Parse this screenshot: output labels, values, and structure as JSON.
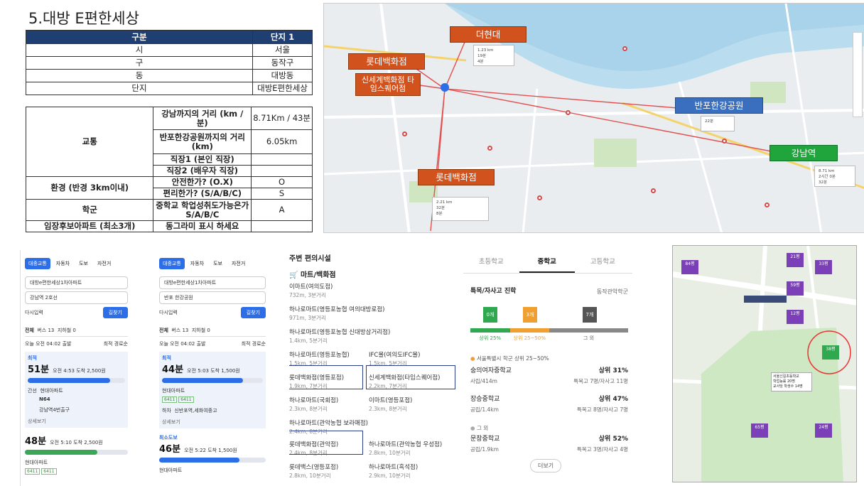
{
  "title": "5.대방 E편한세상",
  "table1": {
    "header": [
      "구분",
      "단지 1"
    ],
    "rows": [
      [
        "시",
        "서울"
      ],
      [
        "구",
        "동작구"
      ],
      [
        "동",
        "대방동"
      ],
      [
        "단지",
        "대방E편한세상"
      ]
    ]
  },
  "table2": {
    "traffic": "교통",
    "r1_label": "강남까지의 거리 (km / 분)",
    "r1_val": "8.71Km / 43분",
    "r2_label": "반포한강공원까지의 거리 (km)",
    "r2_val": "6.05km",
    "r3_label": "직장1 (본인 직장)",
    "r4_label": "직장2 (배우자 직장)",
    "env": "환경 (반경 3km이내)",
    "r5_label": "안전한가? (O.X)",
    "r5_val": "O",
    "r6_label": "편리한가? (S/A/B/C)",
    "r6_val": "S",
    "school": "학군",
    "r7_label": "중학교 학업성취도가능은가 S/A/B/C",
    "r7_val": "A",
    "apt": "임장후보아파트 (최소3개)",
    "r8_label": "동그라미 표시 하세요"
  },
  "map_labels": {
    "hyundai": "더현대",
    "lotte1": "롯데백화점",
    "shinsegae": "신세계백화점 타임스퀘어점",
    "banpo": "반포한강공원",
    "gangnam": "강남역",
    "lotte2": "롯데백화점"
  },
  "route1": {
    "tabs": [
      "대중교통",
      "자동차",
      "도보",
      "자전거"
    ],
    "from": "대방e편한세상1차아파트",
    "to": "강남역 2호선",
    "reset": "다시입력",
    "search": "길찾기",
    "filters": [
      "전체",
      "버스 13",
      "지하철 0"
    ],
    "departure": "오늘 오전 04:02 출발",
    "sort": "최적 경로순",
    "best": "최적",
    "opt1_time": "51분",
    "opt1_detail": "오전 4:53 도착  2,500원",
    "bus_label": "간선",
    "bus_stop": "현대아파트",
    "bus_no": "N64",
    "bus_stop2": "강남역4번출구",
    "detail": "상세보기",
    "opt2_time": "48분",
    "opt2_detail": "오전 5:10 도착  2,500원",
    "opt2_stop": "현대아파트",
    "bus1": "6411",
    "bus2": "6411"
  },
  "route2": {
    "tabs": [
      "대중교통",
      "자동차",
      "도보",
      "자전거"
    ],
    "from": "대방e편한세상1차아파트",
    "to": "반포 한강공원",
    "reset": "다시입력",
    "search": "길찾기",
    "filters": [
      "전체",
      "버스 13",
      "지하철 0"
    ],
    "departure": "오늘 오전 04:02 출발",
    "sort": "최적 경로순",
    "best": "최적",
    "opt1_time": "44분",
    "opt1_detail": "오전 5:03 도착  1,500원",
    "opt1_stop": "현대아파트",
    "bus1": "6411",
    "bus2": "6411",
    "walk_label": "하차",
    "walk_stop": "신반포역,세화여중고",
    "detail": "상세보기",
    "min_walk": "최소도보",
    "opt2_time": "46분",
    "opt2_detail": "오전 5:22 도착  1,500원",
    "opt2_stop": "현대아파트"
  },
  "shop": {
    "h1": "주변 편의시설",
    "h2": "마트/백화점",
    "items": [
      {
        "name": "이마트(여의도점)",
        "sub": "732m, 3분거리"
      },
      {
        "name": "하나로마트(영등포농협 여의대방로점)",
        "sub": "971m, 3분거리"
      },
      {
        "name": "하나로마트(영등포농협 신대방삼거리점)",
        "sub": "1.4km, 5분거리"
      },
      {
        "name": "하나로마트(영등포농협)",
        "sub": "1.5km, 5분거리"
      },
      {
        "name": "IFC몰(여의도IFC몰)",
        "sub": "1.5km, 5분거리"
      },
      {
        "name": "롯데백화점(영등포점)",
        "sub": "1.9km, 7분거리"
      },
      {
        "name": "신세계백화점(타임스퀘어점)",
        "sub": "2.2km, 7분거리"
      },
      {
        "name": "하나로마트(국회점)",
        "sub": "2.3km, 8분거리"
      },
      {
        "name": "이마트(영등포점)",
        "sub": "2.3km, 8분거리"
      },
      {
        "name": "하나로마트(관악농협 보라매점)",
        "sub": "2.4km, 8분거리"
      },
      {
        "name": "롯데백화점(관악점)",
        "sub": "2.4km, 8분거리"
      },
      {
        "name": "하나로마트(관악농협 우성점)",
        "sub": "2.8km, 10분거리"
      },
      {
        "name": "롯데백스(영등포점)",
        "sub": "2.8km, 10분거리"
      },
      {
        "name": "하나로마트(흑석점)",
        "sub": "2.9km, 10분거리"
      }
    ]
  },
  "school": {
    "tabs": [
      "초등학교",
      "중학교",
      "고등학교"
    ],
    "heading": "특목/자사고 진학",
    "district": "동작관악학군",
    "bars": [
      {
        "label": "0개",
        "color": "#2fa84f"
      },
      {
        "label": "3개",
        "color": "#f0a030"
      },
      {
        "label": "7개",
        "color": "#555555"
      }
    ],
    "bar_legend": [
      "상위 25%",
      "상위 25~50%",
      "그 외"
    ],
    "note": "서울특별시 학군 상위 25~50%",
    "schools": [
      {
        "name": "숭의여자중학교",
        "sub": "사립/414m",
        "rank": "상위 31%",
        "stat": "특목고 7명/자사고 11명"
      },
      {
        "name": "장승중학교",
        "sub": "공립/1.4km",
        "rank": "상위 47%",
        "stat": "특목고 8명/자사고 7명"
      },
      {
        "name": "문창중학교",
        "sub": "공립/1.9km",
        "rank": "상위 52%",
        "stat": "특목고 3명/자사고 4명"
      }
    ],
    "other": "그 외",
    "more": "더보기"
  },
  "map2": {
    "tooltip": [
      "서울신길초등학교",
      "학업능률  20명",
      "교사당 학생수 14명"
    ],
    "pins": [
      "84평",
      "21평",
      "33평",
      "59평",
      "12평",
      "38평",
      "65평",
      "24평"
    ]
  }
}
